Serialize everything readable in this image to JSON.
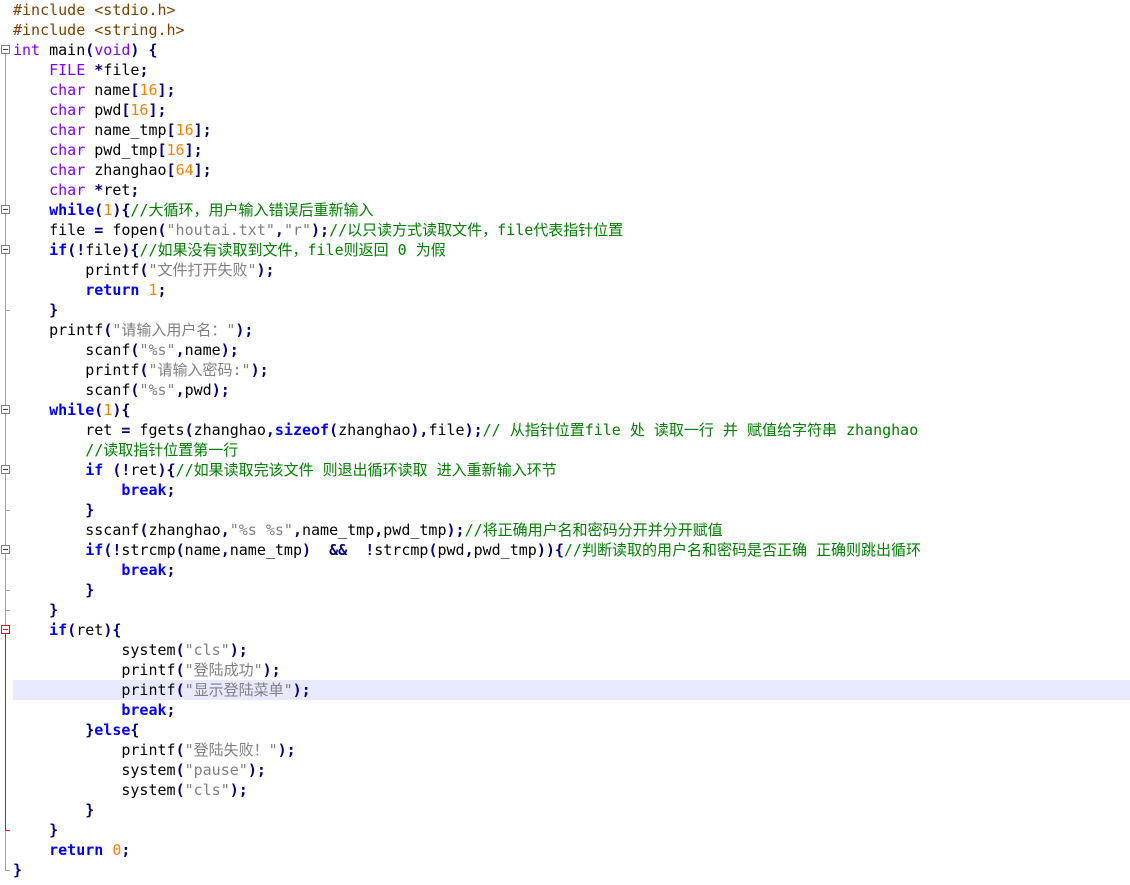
{
  "editor": {
    "language": "C",
    "active_line": 35,
    "colors": {
      "preprocessor": "#804000",
      "type_keyword": "#8000ff",
      "instruction_keyword": "#0000ff",
      "number": "#ff8000",
      "string": "#808080",
      "comment": "#008000",
      "operator": "#000080",
      "active_line_bg": "#e8e8ff",
      "fold_marker": "#808080",
      "fold_marker_active": "#e01010"
    },
    "fold_markers": [
      {
        "start": 3,
        "end": 44,
        "active": false
      },
      {
        "start": 11,
        "end": 31,
        "active": false
      },
      {
        "start": 13,
        "end": 16,
        "active": false
      },
      {
        "start": 21,
        "end": 31,
        "active": false
      },
      {
        "start": 24,
        "end": 26,
        "active": false
      },
      {
        "start": 28,
        "end": 30,
        "active": false
      },
      {
        "start": 32,
        "end": 42,
        "active": true
      }
    ],
    "lines": [
      [
        [
          "pp",
          "#include "
        ],
        [
          "hdr",
          "<stdio.h>"
        ]
      ],
      [
        [
          "pp",
          "#include "
        ],
        [
          "hdr",
          "<string.h>"
        ]
      ],
      [
        [
          "kw",
          "int"
        ],
        [
          "tx",
          " main"
        ],
        [
          "op",
          "("
        ],
        [
          "kw",
          "void"
        ],
        [
          "op",
          ")"
        ],
        [
          "tx",
          " "
        ],
        [
          "op",
          "{"
        ]
      ],
      [
        [
          "tx",
          "    "
        ],
        [
          "kw",
          "FILE"
        ],
        [
          "tx",
          " "
        ],
        [
          "op",
          "*"
        ],
        [
          "tx",
          "file"
        ],
        [
          "op",
          ";"
        ]
      ],
      [
        [
          "tx",
          "    "
        ],
        [
          "kw",
          "char"
        ],
        [
          "tx",
          " name"
        ],
        [
          "op",
          "["
        ],
        [
          "num",
          "16"
        ],
        [
          "op",
          "];"
        ]
      ],
      [
        [
          "tx",
          "    "
        ],
        [
          "kw",
          "char"
        ],
        [
          "tx",
          " pwd"
        ],
        [
          "op",
          "["
        ],
        [
          "num",
          "16"
        ],
        [
          "op",
          "];"
        ]
      ],
      [
        [
          "tx",
          "    "
        ],
        [
          "kw",
          "char"
        ],
        [
          "tx",
          " name_tmp"
        ],
        [
          "op",
          "["
        ],
        [
          "num",
          "16"
        ],
        [
          "op",
          "];"
        ]
      ],
      [
        [
          "tx",
          "    "
        ],
        [
          "kw",
          "char"
        ],
        [
          "tx",
          " pwd_tmp"
        ],
        [
          "op",
          "["
        ],
        [
          "num",
          "16"
        ],
        [
          "op",
          "];"
        ]
      ],
      [
        [
          "tx",
          "    "
        ],
        [
          "kw",
          "char"
        ],
        [
          "tx",
          " zhanghao"
        ],
        [
          "op",
          "["
        ],
        [
          "num",
          "64"
        ],
        [
          "op",
          "];"
        ]
      ],
      [
        [
          "tx",
          "    "
        ],
        [
          "kw",
          "char"
        ],
        [
          "tx",
          " "
        ],
        [
          "op",
          "*"
        ],
        [
          "tx",
          "ret"
        ],
        [
          "op",
          ";"
        ]
      ],
      [
        [
          "tx",
          "    "
        ],
        [
          "kwb",
          "while"
        ],
        [
          "op",
          "("
        ],
        [
          "num",
          "1"
        ],
        [
          "op",
          ")"
        ],
        [
          "op",
          "{"
        ],
        [
          "cmt",
          "//大循环，用户输入错误后重新输入"
        ]
      ],
      [
        [
          "tx",
          "    file "
        ],
        [
          "op",
          "="
        ],
        [
          "tx",
          " fopen"
        ],
        [
          "op",
          "("
        ],
        [
          "str",
          "\"houtai.txt\""
        ],
        [
          "op",
          ","
        ],
        [
          "str",
          "\"r\""
        ],
        [
          "op",
          ");"
        ],
        [
          "cmt",
          "//以只读方式读取文件，file代表指针位置"
        ]
      ],
      [
        [
          "tx",
          "    "
        ],
        [
          "kwb",
          "if"
        ],
        [
          "op",
          "(!"
        ],
        [
          "tx",
          "file"
        ],
        [
          "op",
          ")"
        ],
        [
          "op",
          "{"
        ],
        [
          "cmt",
          "//如果没有读取到文件，file则返回 0 为假"
        ]
      ],
      [
        [
          "tx",
          "        printf"
        ],
        [
          "op",
          "("
        ],
        [
          "str",
          "\"文件打开失败\""
        ],
        [
          "op",
          ");"
        ]
      ],
      [
        [
          "tx",
          "        "
        ],
        [
          "kwb",
          "return"
        ],
        [
          "tx",
          " "
        ],
        [
          "num",
          "1"
        ],
        [
          "op",
          ";"
        ]
      ],
      [
        [
          "tx",
          "    "
        ],
        [
          "op",
          "}"
        ]
      ],
      [
        [
          "tx",
          "    printf"
        ],
        [
          "op",
          "("
        ],
        [
          "str",
          "\"请输入用户名：\""
        ],
        [
          "op",
          ");"
        ]
      ],
      [
        [
          "tx",
          "        scanf"
        ],
        [
          "op",
          "("
        ],
        [
          "str",
          "\"%s\""
        ],
        [
          "op",
          ","
        ],
        [
          "tx",
          "name"
        ],
        [
          "op",
          ");"
        ]
      ],
      [
        [
          "tx",
          "        printf"
        ],
        [
          "op",
          "("
        ],
        [
          "str",
          "\"请输入密码:\""
        ],
        [
          "op",
          ");"
        ]
      ],
      [
        [
          "tx",
          "        scanf"
        ],
        [
          "op",
          "("
        ],
        [
          "str",
          "\"%s\""
        ],
        [
          "op",
          ","
        ],
        [
          "tx",
          "pwd"
        ],
        [
          "op",
          ");"
        ]
      ],
      [
        [
          "tx",
          "    "
        ],
        [
          "kwb",
          "while"
        ],
        [
          "op",
          "("
        ],
        [
          "num",
          "1"
        ],
        [
          "op",
          ")"
        ],
        [
          "op",
          "{"
        ]
      ],
      [
        [
          "tx",
          "        ret "
        ],
        [
          "op",
          "="
        ],
        [
          "tx",
          " fgets"
        ],
        [
          "op",
          "("
        ],
        [
          "tx",
          "zhanghao"
        ],
        [
          "op",
          ","
        ],
        [
          "kwb",
          "sizeof"
        ],
        [
          "op",
          "("
        ],
        [
          "tx",
          "zhanghao"
        ],
        [
          "op",
          "),"
        ],
        [
          "tx",
          "file"
        ],
        [
          "op",
          ");"
        ],
        [
          "cmt",
          "// 从指针位置file 处 读取一行 并 赋值给字符串 zhanghao"
        ]
      ],
      [
        [
          "tx",
          "        "
        ],
        [
          "cmt",
          "//读取指针位置第一行"
        ]
      ],
      [
        [
          "tx",
          "        "
        ],
        [
          "kwb",
          "if"
        ],
        [
          "tx",
          " "
        ],
        [
          "op",
          "(!"
        ],
        [
          "tx",
          "ret"
        ],
        [
          "op",
          ")"
        ],
        [
          "op",
          "{"
        ],
        [
          "cmt",
          "//如果读取完该文件 则退出循环读取 进入重新输入环节"
        ]
      ],
      [
        [
          "tx",
          "            "
        ],
        [
          "kwb",
          "break"
        ],
        [
          "op",
          ";"
        ]
      ],
      [
        [
          "tx",
          "        "
        ],
        [
          "op",
          "}"
        ]
      ],
      [
        [
          "tx",
          "        sscanf"
        ],
        [
          "op",
          "("
        ],
        [
          "tx",
          "zhanghao"
        ],
        [
          "op",
          ","
        ],
        [
          "str",
          "\"%s %s\""
        ],
        [
          "op",
          ","
        ],
        [
          "tx",
          "name_tmp"
        ],
        [
          "op",
          ","
        ],
        [
          "tx",
          "pwd_tmp"
        ],
        [
          "op",
          ");"
        ],
        [
          "cmt",
          "//将正确用户名和密码分开并分开赋值"
        ]
      ],
      [
        [
          "tx",
          "        "
        ],
        [
          "kwb",
          "if"
        ],
        [
          "op",
          "(!"
        ],
        [
          "tx",
          "strcmp"
        ],
        [
          "op",
          "("
        ],
        [
          "tx",
          "name"
        ],
        [
          "op",
          ","
        ],
        [
          "tx",
          "name_tmp"
        ],
        [
          "op",
          ")"
        ],
        [
          "tx",
          "  "
        ],
        [
          "op",
          "&&"
        ],
        [
          "tx",
          "  "
        ],
        [
          "op",
          "!"
        ],
        [
          "tx",
          "strcmp"
        ],
        [
          "op",
          "("
        ],
        [
          "tx",
          "pwd"
        ],
        [
          "op",
          ","
        ],
        [
          "tx",
          "pwd_tmp"
        ],
        [
          "op",
          "))"
        ],
        [
          "op",
          "{"
        ],
        [
          "cmt",
          "//判断读取的用户名和密码是否正确 正确则跳出循环"
        ]
      ],
      [
        [
          "tx",
          "            "
        ],
        [
          "kwb",
          "break"
        ],
        [
          "op",
          ";"
        ]
      ],
      [
        [
          "tx",
          "        "
        ],
        [
          "op",
          "}"
        ]
      ],
      [
        [
          "tx",
          "    "
        ],
        [
          "op",
          "}"
        ]
      ],
      [
        [
          "tx",
          "    "
        ],
        [
          "kwb",
          "if"
        ],
        [
          "op",
          "("
        ],
        [
          "tx",
          "ret"
        ],
        [
          "op",
          ")"
        ],
        [
          "op",
          "{"
        ]
      ],
      [
        [
          "tx",
          "            system"
        ],
        [
          "op",
          "("
        ],
        [
          "str",
          "\"cls\""
        ],
        [
          "op",
          ");"
        ]
      ],
      [
        [
          "tx",
          "            printf"
        ],
        [
          "op",
          "("
        ],
        [
          "str",
          "\"登陆成功\""
        ],
        [
          "op",
          ");"
        ]
      ],
      [
        [
          "tx",
          "            printf"
        ],
        [
          "op",
          "("
        ],
        [
          "str",
          "\"显示登陆菜单\""
        ],
        [
          "op",
          ");"
        ]
      ],
      [
        [
          "tx",
          "            "
        ],
        [
          "kwb",
          "break"
        ],
        [
          "op",
          ";"
        ]
      ],
      [
        [
          "tx",
          "        "
        ],
        [
          "op",
          "}"
        ],
        [
          "kwb",
          "else"
        ],
        [
          "op",
          "{"
        ]
      ],
      [
        [
          "tx",
          "            printf"
        ],
        [
          "op",
          "("
        ],
        [
          "str",
          "\"登陆失败！\""
        ],
        [
          "op",
          ");"
        ]
      ],
      [
        [
          "tx",
          "            system"
        ],
        [
          "op",
          "("
        ],
        [
          "str",
          "\"pause\""
        ],
        [
          "op",
          ");"
        ]
      ],
      [
        [
          "tx",
          "            system"
        ],
        [
          "op",
          "("
        ],
        [
          "str",
          "\"cls\""
        ],
        [
          "op",
          ");"
        ]
      ],
      [
        [
          "tx",
          "        "
        ],
        [
          "op",
          "}"
        ]
      ],
      [
        [
          "tx",
          "    "
        ],
        [
          "op",
          "}"
        ]
      ],
      [
        [
          "tx",
          "    "
        ],
        [
          "kwb",
          "return"
        ],
        [
          "tx",
          " "
        ],
        [
          "num",
          "0"
        ],
        [
          "op",
          ";"
        ]
      ],
      [
        [
          "op",
          "}"
        ]
      ]
    ]
  }
}
